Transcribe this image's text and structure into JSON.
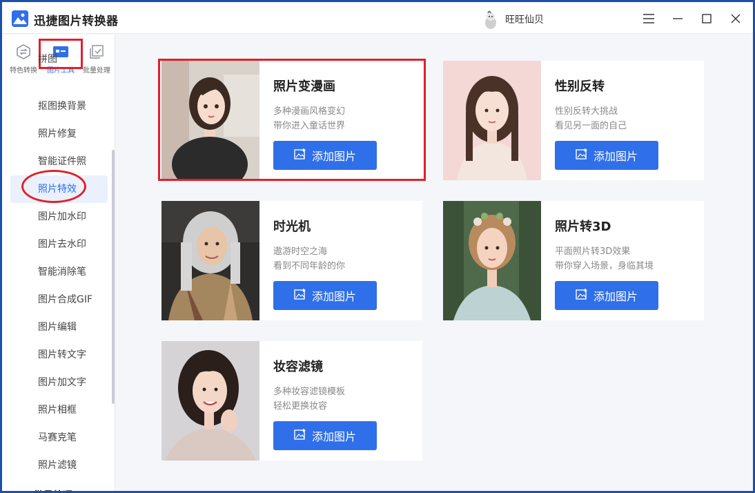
{
  "app": {
    "title": "迅捷图片转换器",
    "user_name": "旺旺仙贝",
    "accent_color": "#2f6fe9",
    "highlight_color": "#e0202a"
  },
  "top_tabs": [
    {
      "label": "特色转换",
      "icon": "convert-icon"
    },
    {
      "label": "图片工具",
      "icon": "image-tool-icon",
      "active": true
    },
    {
      "label": "批量处理",
      "icon": "batch-icon"
    }
  ],
  "sidebar": {
    "items": [
      {
        "label": "拼图"
      },
      {
        "label": "抠图换背景"
      },
      {
        "label": "照片修复"
      },
      {
        "label": "智能证件照"
      },
      {
        "label": "照片特效",
        "active": true
      },
      {
        "label": "图片加水印"
      },
      {
        "label": "图片去水印"
      },
      {
        "label": "智能消除笔"
      },
      {
        "label": "图片合成GIF"
      },
      {
        "label": "图片编辑"
      },
      {
        "label": "图片转文字"
      },
      {
        "label": "图片加文字"
      },
      {
        "label": "照片相框"
      },
      {
        "label": "马赛克笔"
      },
      {
        "label": "照片滤镜"
      },
      {
        "label": "批量处理"
      }
    ]
  },
  "cards": [
    {
      "title": "照片变漫画",
      "desc1": "多种漫画风格变幻",
      "desc2": "带你进入童话世界",
      "button": "添加图片"
    },
    {
      "title": "性别反转",
      "desc1": "性别反转大挑战",
      "desc2": "看见另一面的自己",
      "button": "添加图片"
    },
    {
      "title": "时光机",
      "desc1": "遨游时空之海",
      "desc2": "看到不同年龄的你",
      "button": "添加图片"
    },
    {
      "title": "照片转3D",
      "desc1": "平面照片转3D效果",
      "desc2": "带你穿入场景，身临其境",
      "button": "添加图片"
    },
    {
      "title": "妆容滤镜",
      "desc1": "多种妆容滤镜模板",
      "desc2": "轻松更换妆容",
      "button": "添加图片"
    }
  ]
}
